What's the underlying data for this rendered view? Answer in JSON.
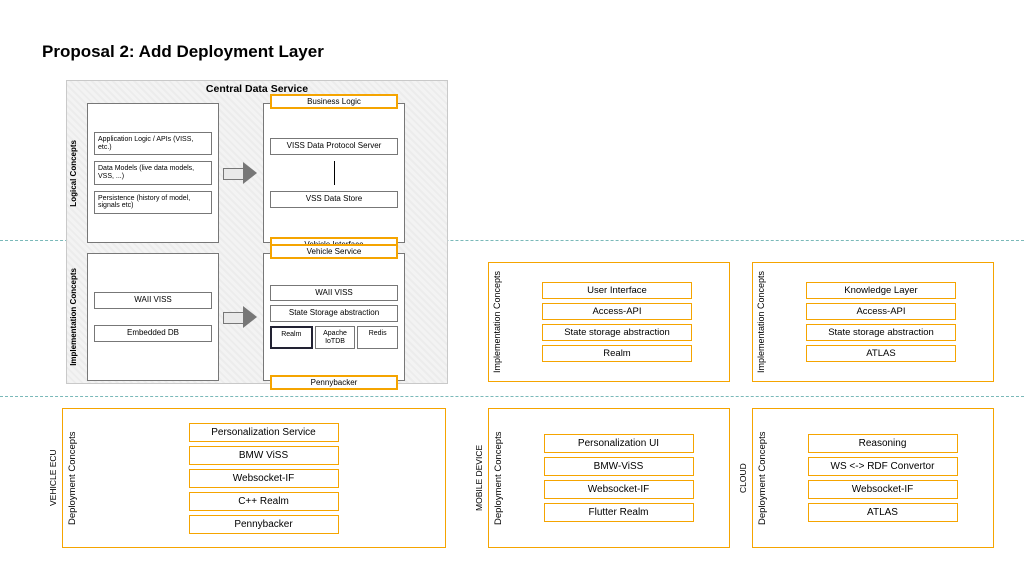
{
  "title": "Proposal 2: Add Deployment Layer",
  "figure": {
    "title": "Central Data Service",
    "logical_label": "Logical Concepts",
    "impl_label": "Implementation\nConcepts",
    "logical_left": {
      "a": "Application Logic / APIs\n(VISS, etc.)",
      "b": "Data Models\n(live data models, VSS, ...)",
      "c": "Persistence\n(history of model, signals etc)"
    },
    "logical_right": {
      "header": "Business Logic",
      "top": "VISS Data Protocol Server",
      "bot": "VSS Data Store",
      "footer": "Vehicle Interface"
    },
    "impl_left": {
      "a": "WAII VISS",
      "b": "Embedded DB"
    },
    "impl_right": {
      "header": "Vehicle Service",
      "a": "WAII VISS",
      "b": "State Storage abstraction",
      "db1": "Realm",
      "db2": "Apache\nIoTDB",
      "db3": "Redis",
      "footer": "Pennybacker"
    }
  },
  "impl_concepts_label": "Implementation\nConcepts",
  "impl_mobile": [
    "User Interface",
    "Access-API",
    "State storage\nabstraction",
    "Realm"
  ],
  "impl_cloud": [
    "Knowledge Layer",
    "Access-API",
    "State storage\nabstraction",
    "ATLAS"
  ],
  "dep_concepts_label": "Deployment\nConcepts",
  "outer_ecu_label": "VEHICLE ECU",
  "outer_mob_label": "MOBILE DEVICE",
  "outer_cloud_label": "CLOUD",
  "dep_ecu": [
    "Personalization Service",
    "BMW ViSS",
    "Websocket-IF",
    "C++ Realm",
    "Pennybacker"
  ],
  "dep_mobile": [
    "Personalization UI",
    "BMW-ViSS",
    "Websocket-IF",
    "Flutter Realm"
  ],
  "dep_cloud": [
    "Reasoning",
    "WS <-> RDF Convertor",
    "Websocket-IF",
    "ATLAS"
  ]
}
